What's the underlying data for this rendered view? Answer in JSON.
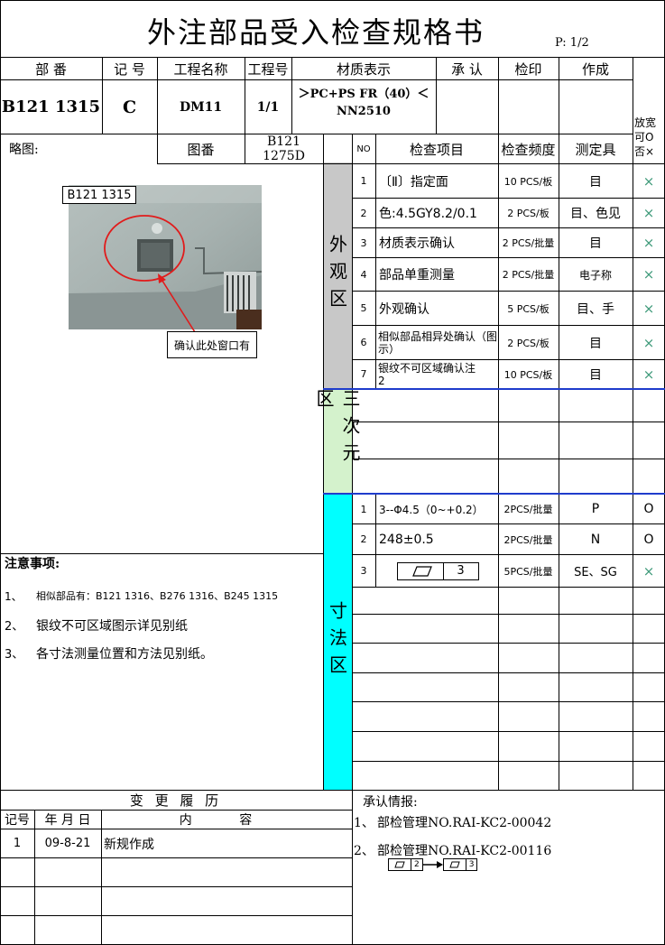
{
  "title": "外注部品受入检查规格书",
  "page_no": "P: 1/2",
  "header": {
    "labels": {
      "part_no": "部 番",
      "record_no": "记 号",
      "process_name": "工程名称",
      "process_no": "工程号",
      "material": "材质表示",
      "approve": "承 认",
      "inspect_seal": "检印",
      "author": "作成"
    },
    "values": {
      "part_no": "B121 1315",
      "record_no": "C",
      "process_name": "DM11",
      "process_no": "1/1",
      "material_l1": "＞PC+PS FR（40）＜",
      "material_l2": "NN2510"
    }
  },
  "sketch": {
    "label": "略图:",
    "drawing_no_label": "图番",
    "drawing_no": "B121 1275D",
    "photo_label": "B121 1315",
    "callout": "确认此处窗口有"
  },
  "table": {
    "headers": {
      "no": "NO",
      "item": "检查项目",
      "freq": "检查频度",
      "tool": "测定具",
      "judge": "放宽可O否×"
    },
    "zones": {
      "appearance": "外观区",
      "three_d": "三次元区",
      "dimension": "寸法区"
    },
    "appearance_rows": [
      {
        "no": "1",
        "item": "〔Ⅱ〕指定面",
        "freq": "10 PCS/板",
        "tool": "目",
        "judge": "×"
      },
      {
        "no": "2",
        "item": "色:4.5GY8.2/0.1",
        "freq": "2 PCS/板",
        "tool": "目、色见",
        "judge": "×"
      },
      {
        "no": "3",
        "item": "材质表示确认",
        "freq": "2 PCS/批量",
        "tool": "目",
        "judge": "×"
      },
      {
        "no": "4",
        "item": "部品单重测量",
        "freq": "2 PCS/批量",
        "tool": "电子称",
        "judge": "×"
      },
      {
        "no": "5",
        "item": "外观确认",
        "freq": "5 PCS/板",
        "tool": "目、手",
        "judge": "×"
      },
      {
        "no": "6",
        "item": "相似部品相异处确认（图示）",
        "freq": "2 PCS/板",
        "tool": "目",
        "judge": "×"
      },
      {
        "no": "7",
        "item": "银纹不可区域确认注2",
        "freq": "10 PCS/板",
        "tool": "目",
        "judge": "×"
      }
    ],
    "dimension_rows": [
      {
        "no": "1",
        "item": "3--Φ4.5（0~+0.2）",
        "freq": "2PCS/批量",
        "tool": "P",
        "judge": "O"
      },
      {
        "no": "2",
        "item": "248±0.5",
        "freq": "2PCS/批量",
        "tool": "N",
        "judge": "O"
      },
      {
        "no": "3",
        "item": "3",
        "freq": "5PCS/批量",
        "tool": "SE、SG",
        "judge": "×"
      }
    ]
  },
  "notes": {
    "title": "注意事项:",
    "items": [
      {
        "no": "1、",
        "text": "相似部品有：B121 1316、B276 1316、B245 1315"
      },
      {
        "no": "2、",
        "text": "银纹不可区域图示详见别纸"
      },
      {
        "no": "3、",
        "text": "各寸法测量位置和方法见别纸。"
      }
    ]
  },
  "history": {
    "title": "变 更 履 历",
    "headers": {
      "no": "记号",
      "date": "年 月 日",
      "content": "内 容"
    },
    "rows": [
      {
        "no": "1",
        "date": "09-8-21",
        "content": "新规作成"
      }
    ]
  },
  "approval": {
    "title": "承认情报:",
    "items": [
      {
        "no": "1、",
        "text": "部检管理NO.RAI-KC2-00042"
      },
      {
        "no": "2、",
        "text": "部检管理NO.RAI-KC2-00116"
      }
    ],
    "change_from": "2",
    "change_to": "3"
  },
  "colors": {
    "zone_appearance": "#c8c8c8",
    "zone_three_d": "#d4f2cc",
    "zone_dimension": "#00ffff",
    "judge_mark": "#3f9a7a",
    "divider_blue": "#1f3ccc",
    "callout_circle": "#e11b1b"
  }
}
